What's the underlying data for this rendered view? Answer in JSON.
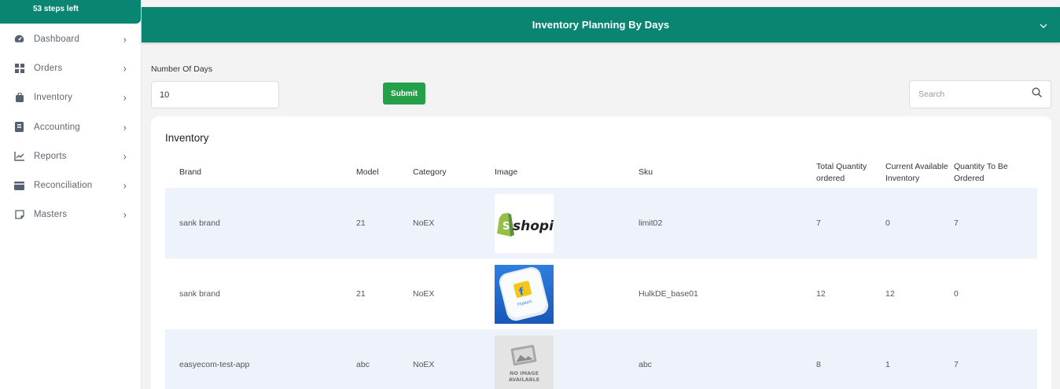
{
  "sidebar": {
    "steps_left": "53 steps left",
    "items": [
      {
        "label": "Dashboard",
        "icon": "dashboard-icon"
      },
      {
        "label": "Orders",
        "icon": "grid-icon"
      },
      {
        "label": "Inventory",
        "icon": "bag-icon"
      },
      {
        "label": "Accounting",
        "icon": "book-icon"
      },
      {
        "label": "Reports",
        "icon": "chart-icon"
      },
      {
        "label": "Reconciliation",
        "icon": "wallet-icon"
      },
      {
        "label": "Masters",
        "icon": "note-icon"
      }
    ]
  },
  "header": {
    "title": "Inventory Planning By Days"
  },
  "form": {
    "days_label": "Number Of Days",
    "days_value": "10",
    "submit_label": "Submit",
    "search_placeholder": "Search"
  },
  "table": {
    "title": "Inventory",
    "headers": {
      "brand": "Brand",
      "model": "Model",
      "category": "Category",
      "image": "Image",
      "sku": "Sku",
      "total_qty": "Total Quantity ordered",
      "available": "Current Available Inventory",
      "to_order": "Quantity To Be Ordered"
    },
    "rows": [
      {
        "brand": "sank brand",
        "model": "21",
        "category": "NoEX",
        "image": "shopify-logo",
        "image_text": "shopify",
        "sku": "limit02",
        "total_qty": "7",
        "available": "0",
        "to_order": "7"
      },
      {
        "brand": "sank brand",
        "model": "21",
        "category": "NoEX",
        "image": "flipkart-logo",
        "image_text": "Flipkart",
        "sku": "HulkDE_base01",
        "total_qty": "12",
        "available": "12",
        "to_order": "0"
      },
      {
        "brand": "easyecom-test-app",
        "model": "abc",
        "category": "NoEX",
        "image": "no-image-placeholder",
        "image_text": "NO IMAGE AVAILABLE",
        "sku": "abc",
        "total_qty": "8",
        "available": "1",
        "to_order": "7"
      }
    ]
  },
  "colors": {
    "primary": "#0a8572",
    "submit": "#23a049",
    "row_alt": "#eef2fa"
  }
}
